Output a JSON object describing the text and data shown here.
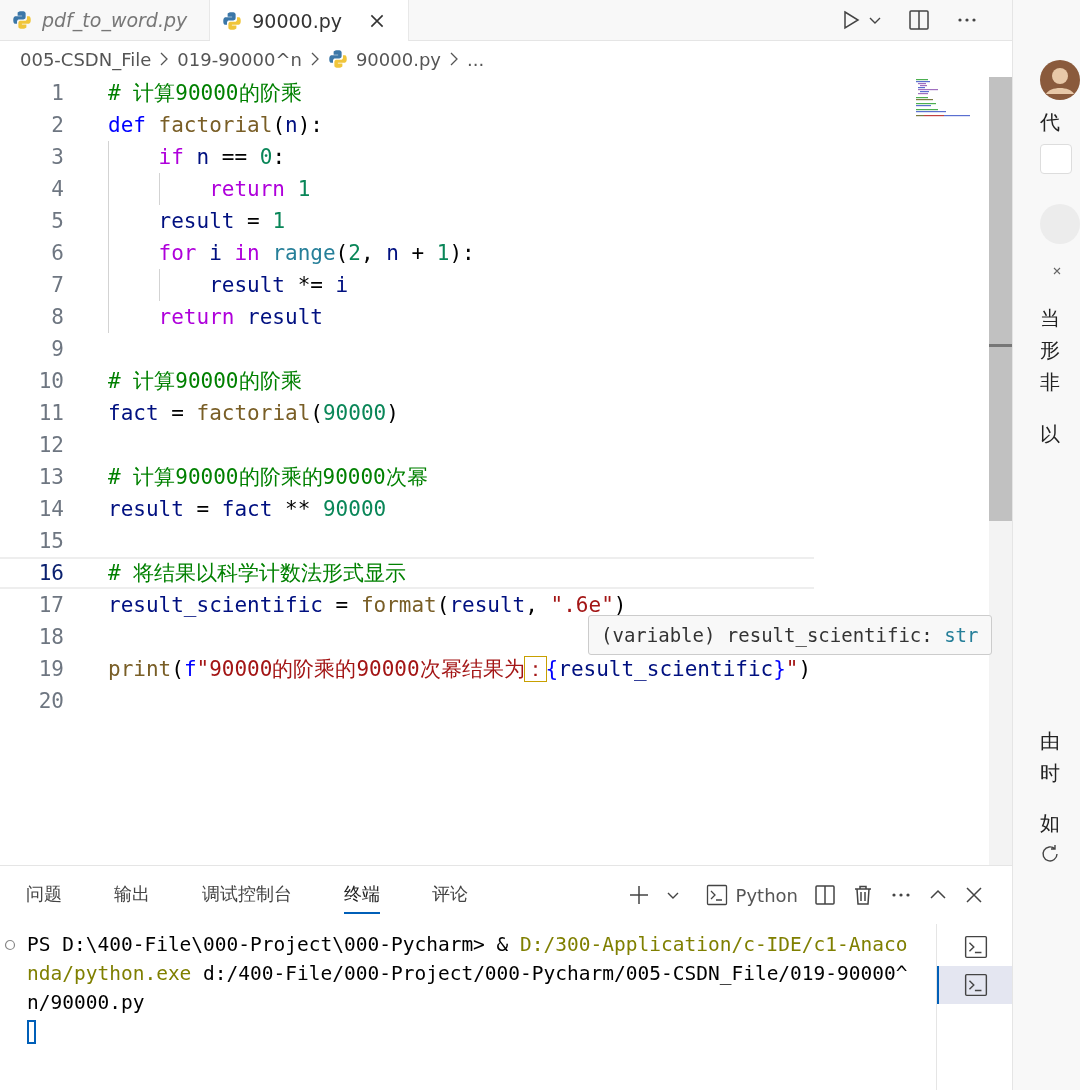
{
  "tabs": [
    {
      "label": "pdf_to_word.py",
      "selected": false,
      "preview": true
    },
    {
      "label": "90000.py",
      "selected": true,
      "preview": false
    }
  ],
  "breadcrumb": [
    {
      "label": "005-CSDN_File",
      "kind": "folder"
    },
    {
      "label": "019-90000^n",
      "kind": "folder"
    },
    {
      "label": "90000.py",
      "kind": "file"
    },
    {
      "label": "...",
      "kind": "more"
    }
  ],
  "code_lines": [
    {
      "number": "1",
      "current": false,
      "tokens": [
        {
          "kind": "com",
          "text": "# 计算90000的阶乘"
        }
      ]
    },
    {
      "number": "2",
      "current": false,
      "tokens": [
        {
          "kind": "kw",
          "text": "def"
        },
        {
          "kind": "fn",
          "text": " factorial"
        },
        {
          "kind": "plain",
          "text": "("
        },
        {
          "kind": "var",
          "text": "n"
        },
        {
          "kind": "plain",
          "text": "):"
        }
      ]
    },
    {
      "number": "3",
      "current": false,
      "tokens": [
        {
          "kind": "ctl",
          "text": "    if"
        },
        {
          "kind": "var",
          "text": " n"
        },
        {
          "kind": "plain",
          "text": " =="
        },
        {
          "kind": "num",
          "text": " 0"
        },
        {
          "kind": "plain",
          "text": ":"
        }
      ]
    },
    {
      "number": "4",
      "current": false,
      "tokens": [
        {
          "kind": "ctl",
          "text": "        return"
        },
        {
          "kind": "num",
          "text": " 1"
        }
      ]
    },
    {
      "number": "5",
      "current": false,
      "tokens": [
        {
          "kind": "var",
          "text": "    result"
        },
        {
          "kind": "plain",
          "text": " ="
        },
        {
          "kind": "num",
          "text": " 1"
        }
      ]
    },
    {
      "number": "6",
      "current": false,
      "tokens": [
        {
          "kind": "ctl",
          "text": "    for"
        },
        {
          "kind": "var",
          "text": " i"
        },
        {
          "kind": "ctl",
          "text": " in"
        },
        {
          "kind": "cls",
          "text": " range"
        },
        {
          "kind": "plain",
          "text": "("
        },
        {
          "kind": "num",
          "text": "2"
        },
        {
          "kind": "plain",
          "text": ","
        },
        {
          "kind": "var",
          "text": " n"
        },
        {
          "kind": "plain",
          "text": " +"
        },
        {
          "kind": "num",
          "text": " 1"
        },
        {
          "kind": "plain",
          "text": "):"
        }
      ]
    },
    {
      "number": "7",
      "current": false,
      "tokens": [
        {
          "kind": "var",
          "text": "        result"
        },
        {
          "kind": "plain",
          "text": " *="
        },
        {
          "kind": "var",
          "text": " i"
        }
      ]
    },
    {
      "number": "8",
      "current": false,
      "tokens": [
        {
          "kind": "ctl",
          "text": "    return"
        },
        {
          "kind": "var",
          "text": " result"
        }
      ]
    },
    {
      "number": "9",
      "current": false
    },
    {
      "number": "10",
      "current": false,
      "tokens": [
        {
          "kind": "com",
          "text": "# 计算90000的阶乘"
        }
      ]
    },
    {
      "number": "11",
      "current": false,
      "tokens": [
        {
          "kind": "var",
          "text": "fact"
        },
        {
          "kind": "plain",
          "text": " ="
        },
        {
          "kind": "fn",
          "text": " factorial"
        },
        {
          "kind": "plain",
          "text": "("
        },
        {
          "kind": "num",
          "text": "90000"
        },
        {
          "kind": "plain",
          "text": ")"
        }
      ]
    },
    {
      "number": "12",
      "current": false
    },
    {
      "number": "13",
      "current": false,
      "tokens": [
        {
          "kind": "com",
          "text": "# 计算90000的阶乘的90000次幂"
        }
      ]
    },
    {
      "number": "14",
      "current": false,
      "tokens": [
        {
          "kind": "var",
          "text": "result"
        },
        {
          "kind": "plain",
          "text": " ="
        },
        {
          "kind": "var",
          "text": " fact"
        },
        {
          "kind": "plain",
          "text": " **"
        },
        {
          "kind": "num",
          "text": " 90000"
        }
      ]
    },
    {
      "number": "15",
      "current": false
    },
    {
      "number": "16",
      "current": true,
      "tokens": [
        {
          "kind": "com",
          "text": "# 将结果以科学计数法形式显示"
        }
      ]
    },
    {
      "number": "17",
      "current": false,
      "tokens": [
        {
          "kind": "var",
          "text": "result_scientific"
        },
        {
          "kind": "plain",
          "text": " ="
        },
        {
          "kind": "fn",
          "text": " format"
        },
        {
          "kind": "plain",
          "text": "("
        },
        {
          "kind": "var",
          "text": "result"
        },
        {
          "kind": "plain",
          "text": ","
        },
        {
          "kind": "str",
          "text": " \".6e\""
        },
        {
          "kind": "plain",
          "text": ")"
        }
      ]
    },
    {
      "number": "18",
      "current": false
    },
    {
      "number": "19",
      "current": false,
      "tokens": [
        {
          "kind": "fn",
          "text": "print"
        },
        {
          "kind": "plain",
          "text": "("
        },
        {
          "kind": "kw",
          "text": "f"
        },
        {
          "kind": "str",
          "text": "\"90000的阶乘的90000次幂结果为"
        },
        {
          "kind": "warn",
          "text": "："
        },
        {
          "kind": "kw",
          "text": "{"
        },
        {
          "kind": "var",
          "text": "result_scientific"
        },
        {
          "kind": "kw",
          "text": "}"
        },
        {
          "kind": "str",
          "text": "\""
        },
        {
          "kind": "plain",
          "text": ")"
        }
      ]
    },
    {
      "number": "20",
      "current": false
    }
  ],
  "hover": {
    "text": "(variable) result_scientific:",
    "type": "str"
  },
  "panel": {
    "tabs": [
      {
        "label": "问题",
        "selected": false
      },
      {
        "label": "输出",
        "selected": false
      },
      {
        "label": "调试控制台",
        "selected": false
      },
      {
        "label": "终端",
        "selected": true
      },
      {
        "label": "评论",
        "selected": false
      }
    ],
    "terminal_profile": "Python",
    "terminal_lines": [
      [
        {
          "kind": "plain",
          "text": "PS D:\\400-File\\000-Project\\000-Pycharm> &"
        },
        {
          "kind": "path",
          "text": " D:/300-Application/c-IDE/c1-Anaco"
        }
      ],
      [
        {
          "kind": "path",
          "text": "nda/python.exe"
        },
        {
          "kind": "plain",
          "text": " d:/400-File/000-Project/000-Pycharm/005-CSDN_File/019-90000^"
        }
      ],
      [
        {
          "kind": "plain",
          "text": "n/90000.py"
        }
      ]
    ],
    "terminals": [
      {
        "selected": false
      },
      {
        "selected": true
      }
    ]
  },
  "side_panel": {
    "heading": "代",
    "paragraphs": [
      [
        "当",
        "形",
        "非"
      ],
      [
        "以"
      ],
      [
        "由",
        "时"
      ],
      [
        "如"
      ]
    ]
  }
}
